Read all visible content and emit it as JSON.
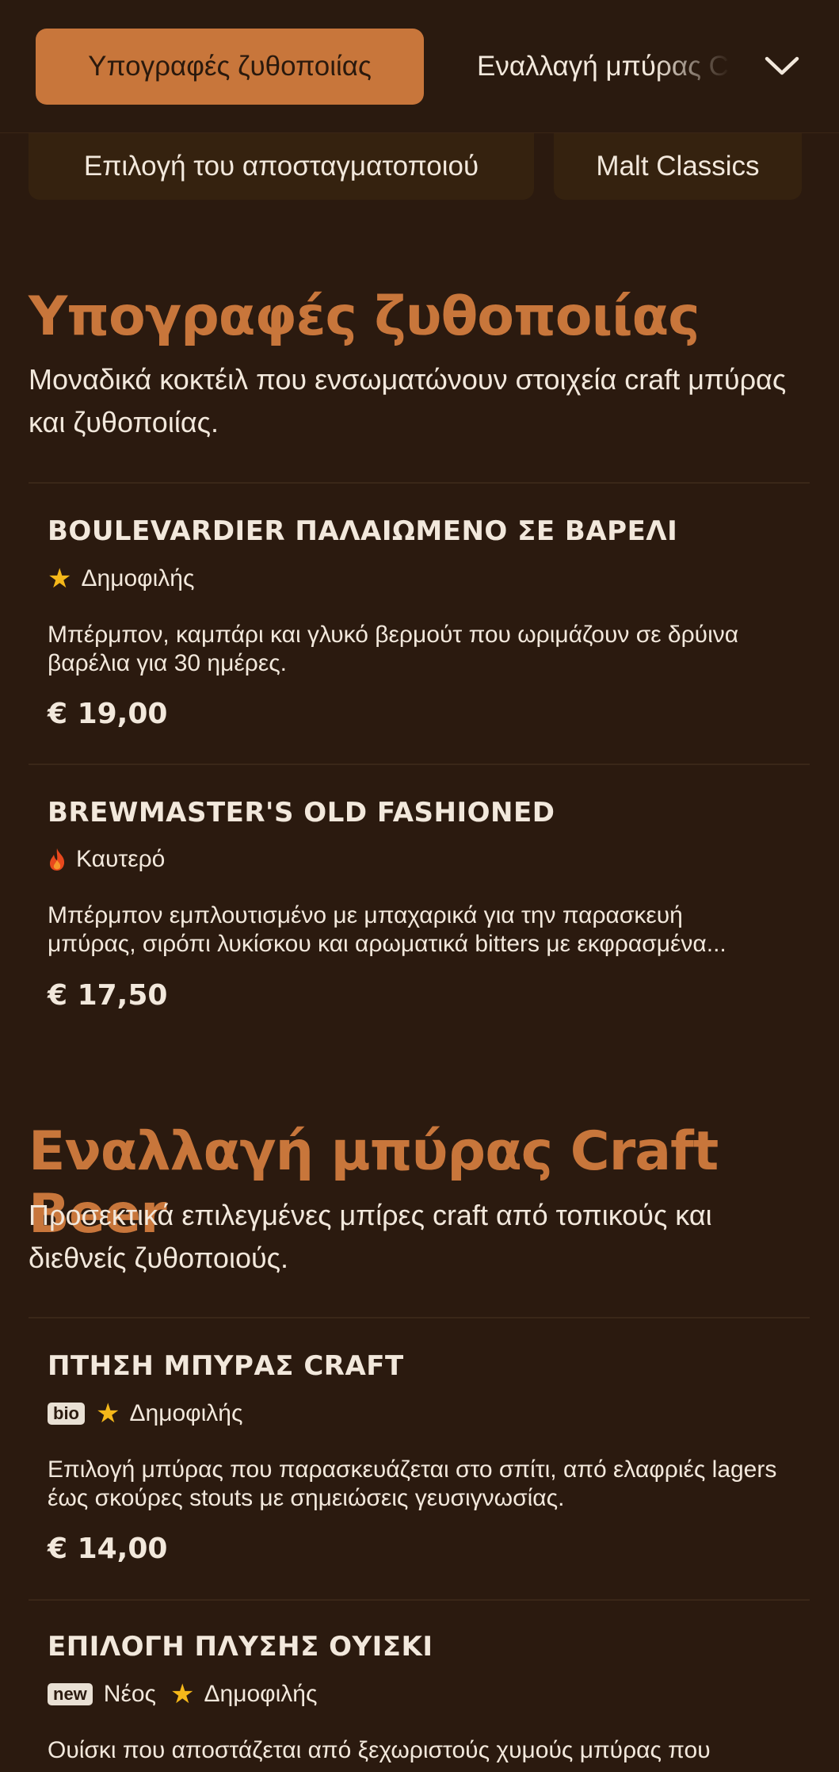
{
  "nav": {
    "active_tab": "Υπογραφές ζυθοποιίας",
    "next_tab": "Εναλλαγή μπύρας Craft Beer",
    "chips": [
      "Επιλογή του αποσταγματοποιού",
      "Malt Classics"
    ]
  },
  "sections": [
    {
      "title": "Υπογραφές ζυθοποιίας",
      "description": "Μοναδικά κοκτέιλ που ενσωματώνουν στοιχεία craft μπύρας και ζυθοποιίας.",
      "items": [
        {
          "name": "BOULEVARDIER ΠΑΛΑΙΩΜΕΝΟ ΣΕ ΒΑΡΕΛΙ",
          "tag": "Δημοφιλής",
          "description": "Μπέρμπον, καμπάρι και γλυκό βερμούτ που ωριμάζουν σε δρύινα βαρέλια για 30 ημέρες.",
          "price": "€ 19,00"
        },
        {
          "name": "BREWMASTER'S OLD FASHIONED",
          "tag": "Καυτερό",
          "description_line1": "Μπέρμπον εμπλουτισμένο με μπαχαρικά για την παρασκευή",
          "description_line2": "μπύρας, σιρόπι λυκίσκου και αρωματικά bitters με εκφρασμένα...",
          "price": "€ 17,50"
        }
      ]
    },
    {
      "title": "Εναλλαγή μπύρας Craft Beer",
      "description": "Προσεκτικά επιλεγμένες μπίρες craft από τοπικούς και διεθνείς ζυθοποιούς.",
      "items": [
        {
          "name": "ΠΤΗΣΗ ΜΠΥΡΑΣ CRAFT",
          "badge": "bio",
          "tag": "Δημοφιλής",
          "description": "Επιλογή μπύρας που παρασκευάζεται στο σπίτι, από ελαφριές lagers έως σκούρες stouts με σημειώσεις γευσιγνωσίας.",
          "price": "€ 14,00"
        },
        {
          "name": "ΕΠΙΛΟΓΗ ΠΛΥΣΗΣ ΟΥΙΣΚΙ",
          "badge": "new",
          "tag1": "Νέος",
          "tag2": "Δημοφιλής",
          "description": "Ουίσκι που αποστάζεται από ξεχωριστούς χυμούς μπύρας που"
        }
      ]
    }
  ],
  "colors": {
    "accent": "#c8763b",
    "background": "#2b1a0f",
    "star": "#f5b81a"
  }
}
